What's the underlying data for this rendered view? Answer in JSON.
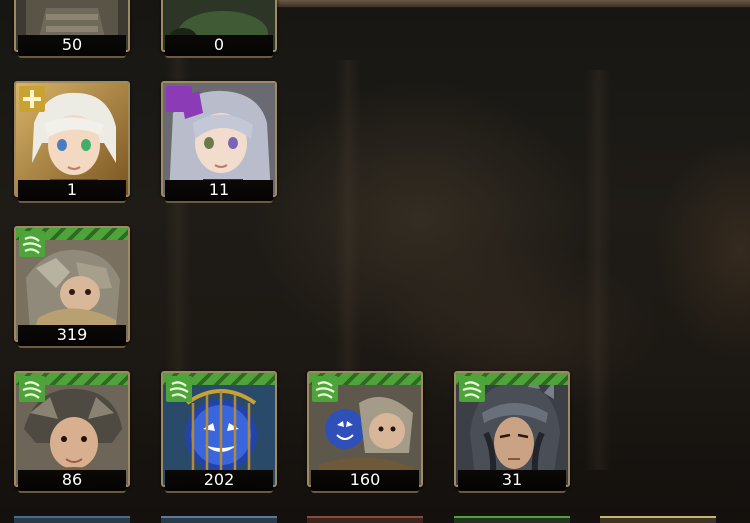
{
  "cards": [
    {
      "count": "50",
      "element": "unknown",
      "element_color": "#7a6a4a",
      "character": "armored-warrior",
      "partial": "top"
    },
    {
      "count": "0",
      "element": "unknown",
      "element_color": "#4f6a3a",
      "character": "green-figure",
      "partial": "top"
    },
    {
      "count": "1",
      "element": "light",
      "element_color": "#c9a233",
      "character": "white-haired-boy"
    },
    {
      "count": "11",
      "element": "dark",
      "element_color": "#8a3bb5",
      "character": "silver-haired-girl"
    },
    {
      "count": "319",
      "element": "wind",
      "element_color": "#4ea33a",
      "character": "owl-creature"
    },
    {
      "count": "86",
      "element": "wind",
      "element_color": "#4ea33a",
      "character": "horned-fairy"
    },
    {
      "count": "202",
      "element": "wind",
      "element_color": "#4ea33a",
      "character": "caged-blue-spirit"
    },
    {
      "count": "160",
      "element": "wind",
      "element_color": "#4ea33a",
      "character": "spirit-with-owl"
    },
    {
      "count": "31",
      "element": "wind",
      "element_color": "#4ea33a",
      "character": "helmeted-warrior"
    }
  ],
  "bottom_row_frame_colors": [
    "#4a6a8a",
    "#5a7a9a",
    "#8a4a3a",
    "#4ea33a",
    "#c9b46a"
  ]
}
